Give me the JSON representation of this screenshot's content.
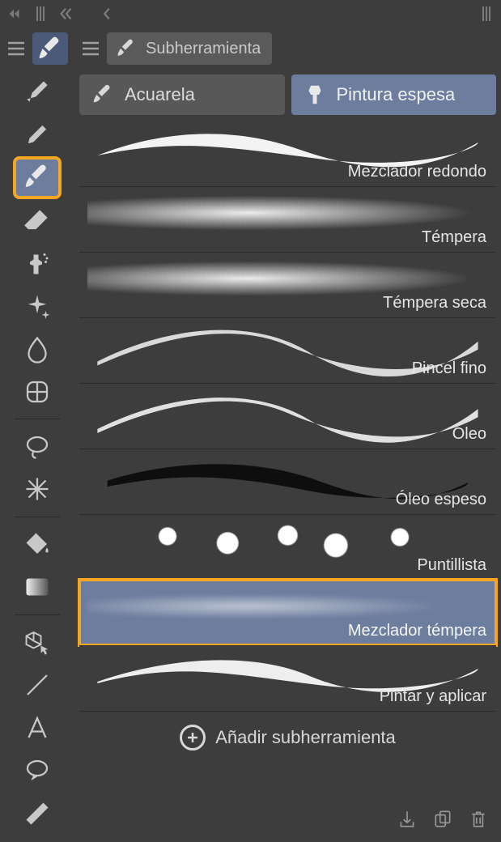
{
  "top_nav": {
    "back_double_icon": "chevron-double-left-icon",
    "back_icon": "chevron-left-icon",
    "forward_icon": "chevron-right-icon"
  },
  "toolbar": {
    "items": [
      {
        "name": "pen-tool-icon"
      },
      {
        "name": "pencil-tool-icon"
      },
      {
        "name": "brush-tool-icon",
        "selected": true
      },
      {
        "name": "eraser-tool-icon"
      },
      {
        "name": "airbrush-tool-icon"
      },
      {
        "name": "decoration-tool-icon"
      },
      {
        "name": "blend-tool-icon"
      },
      {
        "name": "liquify-tool-icon"
      },
      {
        "name": "lasso-tool-icon"
      },
      {
        "name": "sparkle-tool-icon"
      },
      {
        "name": "fill-tool-icon"
      },
      {
        "name": "gradient-tool-icon"
      },
      {
        "name": "object-select-tool-icon"
      },
      {
        "name": "line-tool-icon"
      },
      {
        "name": "text-tool-icon"
      },
      {
        "name": "balloon-tool-icon"
      },
      {
        "name": "ruler-tool-icon"
      }
    ]
  },
  "panel": {
    "header_label": "Subherramienta",
    "categories": [
      {
        "key": "acuarela",
        "label": "Acuarela",
        "selected": false
      },
      {
        "key": "pintura",
        "label": "Pintura espesa",
        "selected": true
      }
    ],
    "brushes": [
      {
        "label": "Mezclador redondo",
        "style": "smooth",
        "selected": false
      },
      {
        "label": "Témpera",
        "style": "tex",
        "selected": false
      },
      {
        "label": "Témpera seca",
        "style": "tex-noise",
        "selected": false
      },
      {
        "label": "Pincel fino",
        "style": "wave-tex",
        "selected": false
      },
      {
        "label": "Óleo",
        "style": "wave-tex",
        "selected": false
      },
      {
        "label": "Óleo espeso",
        "style": "dark",
        "selected": false
      },
      {
        "label": "Puntillista",
        "style": "chunky",
        "selected": false
      },
      {
        "label": "Mezclador témpera",
        "style": "soft",
        "selected": true
      },
      {
        "label": "Pintar y aplicar",
        "style": "smooth2",
        "selected": false
      }
    ],
    "add_subtool_label": "Añadir subherramienta",
    "footer_icons": {
      "download": "import-icon",
      "duplicate": "duplicate-icon",
      "trash": "trash-icon"
    }
  }
}
